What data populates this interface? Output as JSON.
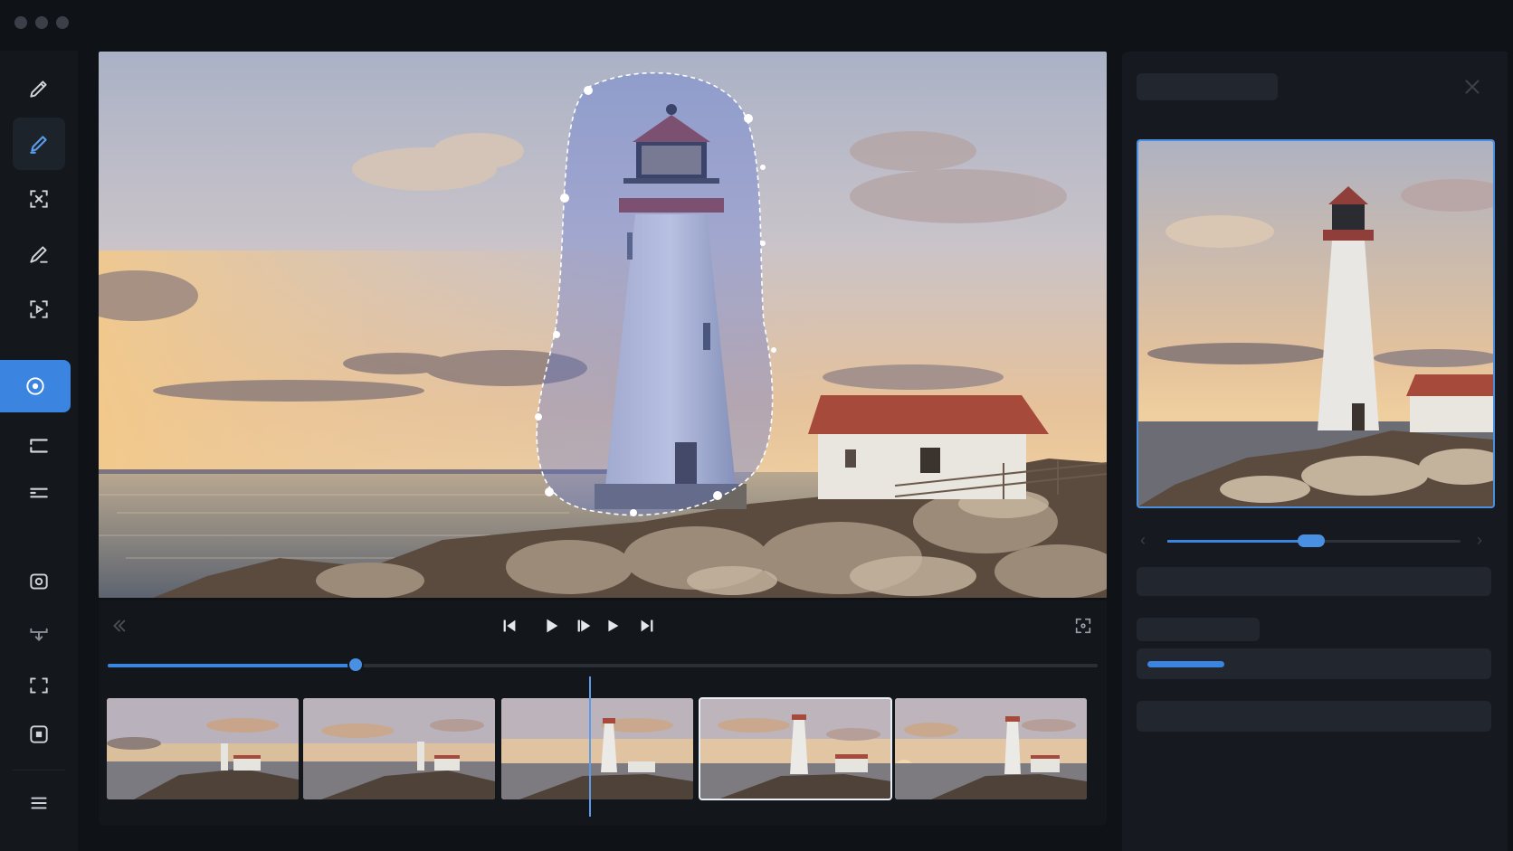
{
  "window": {
    "controls": [
      "close",
      "minimize",
      "maximize"
    ]
  },
  "toolbar": {
    "tools": [
      {
        "name": "pencil-tool",
        "icon": "pencil-icon",
        "state": "normal"
      },
      {
        "name": "brush-tool",
        "icon": "brush-icon",
        "state": "active"
      },
      {
        "name": "marquee-tool",
        "icon": "marquee-select-icon",
        "state": "normal"
      },
      {
        "name": "pen-tool",
        "icon": "pen-icon",
        "state": "normal"
      },
      {
        "name": "object-select-tool",
        "icon": "object-select-icon",
        "state": "normal"
      },
      {
        "name": "mask-tool",
        "icon": "circle-mask-icon",
        "state": "selected"
      },
      {
        "name": "layers-tool",
        "icon": "layers-icon",
        "state": "normal"
      },
      {
        "name": "stack-tool",
        "icon": "stack-icon",
        "state": "normal"
      },
      {
        "name": "camera-tool",
        "icon": "camera-icon",
        "state": "normal"
      },
      {
        "name": "download-tool",
        "icon": "download-icon",
        "state": "normal"
      },
      {
        "name": "crop-tool",
        "icon": "crop-icon",
        "state": "normal"
      },
      {
        "name": "frame-tool",
        "icon": "frame-icon",
        "state": "normal"
      },
      {
        "name": "menu-tool",
        "icon": "menu-icon",
        "state": "normal"
      }
    ]
  },
  "transport": {
    "buttons": [
      "collapse-icon",
      "skip-start-icon",
      "play-icon",
      "step-forward-icon",
      "play-alt-icon",
      "skip-end-icon",
      "fullscreen-icon"
    ]
  },
  "timeline": {
    "progress": 0.25,
    "frames": 5,
    "selected_frame": 4
  },
  "panel": {
    "preview_slider": 0.49,
    "progress_bar": 0.23,
    "close_icon": "close-icon"
  },
  "colors": {
    "accent": "#3b84e0",
    "background": "#0f1216",
    "panel": "#161a20"
  }
}
